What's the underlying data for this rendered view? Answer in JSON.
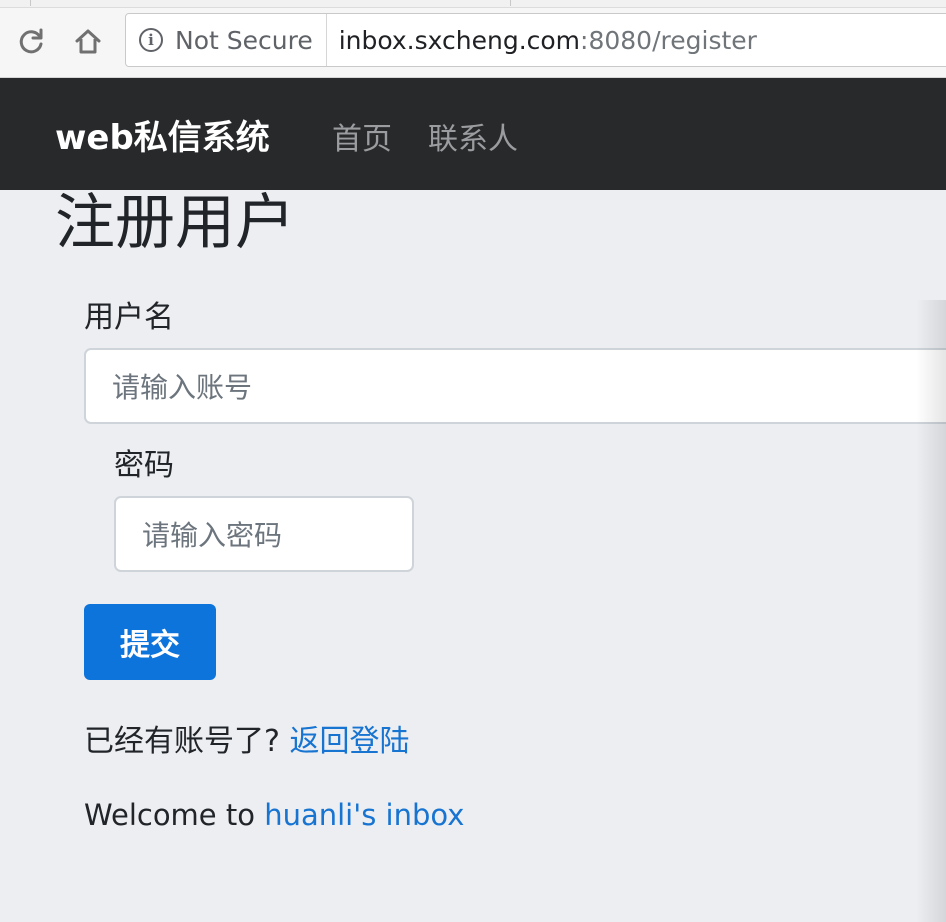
{
  "browser": {
    "security_label": "Not Secure",
    "url_host": "inbox.sxcheng.com",
    "url_rest": ":8080/register"
  },
  "navbar": {
    "brand": "web私信系统",
    "links": [
      "首页",
      "联系人"
    ]
  },
  "page": {
    "title": "注册用户"
  },
  "form": {
    "username_label": "用户名",
    "username_placeholder": "请输入账号",
    "password_label": "密码",
    "password_placeholder": "请输入密码",
    "submit_label": "提交"
  },
  "footer": {
    "have_account_text": "已经有账号了?",
    "back_login_link": "返回登陆",
    "welcome_text": "Welcome to ",
    "welcome_link": "huanli's inbox"
  }
}
